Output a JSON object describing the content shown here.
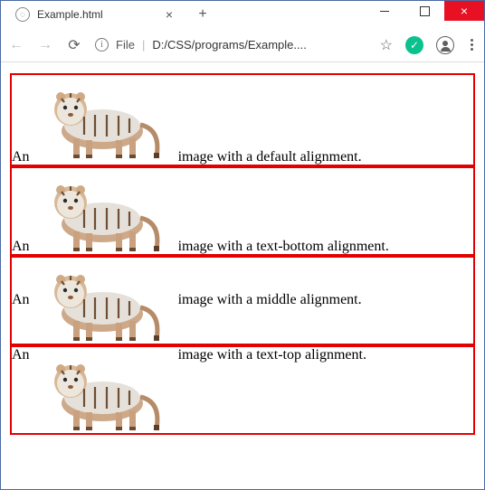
{
  "window": {
    "tab_title": "Example.html",
    "new_tab_glyph": "+",
    "close_tab_glyph": "×",
    "close_window_glyph": "×"
  },
  "addressbar": {
    "file_label": "File",
    "path_display": "D:/CSS/programs/Example....",
    "extension_glyph": "✓"
  },
  "rows": [
    {
      "pre": "An",
      "post": "image with a default alignment.",
      "va": "va-baseline"
    },
    {
      "pre": "An",
      "post": "image with a text-bottom alignment.",
      "va": "va-text-bottom"
    },
    {
      "pre": "An",
      "post": "image with a middle alignment.",
      "va": "va-middle"
    },
    {
      "pre": "An",
      "post": "image with a text-top alignment.",
      "va": "va-text-top"
    }
  ]
}
